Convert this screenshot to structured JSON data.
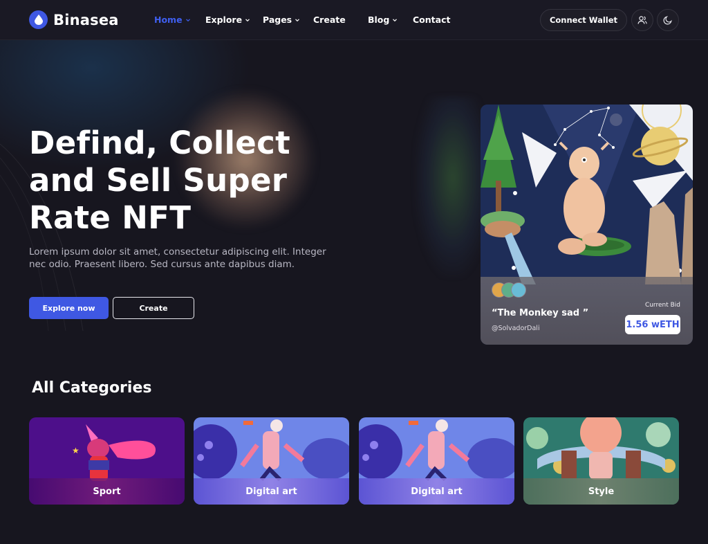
{
  "brand": {
    "name": "Binasea"
  },
  "nav": {
    "items": [
      {
        "label": "Home",
        "active": true,
        "has_dropdown": true
      },
      {
        "label": "Explore",
        "active": false,
        "has_dropdown": true
      },
      {
        "label": "Pages",
        "active": false,
        "has_dropdown": true
      },
      {
        "label": "Create",
        "active": false,
        "has_dropdown": false
      },
      {
        "label": "Blog",
        "active": false,
        "has_dropdown": true
      },
      {
        "label": "Contact",
        "active": false,
        "has_dropdown": false
      }
    ],
    "connect_wallet": "Connect Wallet",
    "icons": [
      "user-icon",
      "moon-icon"
    ]
  },
  "hero": {
    "title": "Defind, Collect and Sell Super Rate NFT",
    "description": "Lorem ipsum dolor sit amet, consectetur adipiscing elit. Integer nec odio. Praesent libero. Sed cursus ante dapibus diam.",
    "explore_button": "Explore now",
    "create_button": "Create"
  },
  "nft_card": {
    "title": "“The Monkey sad ”",
    "author": "@SolvadorDali",
    "bid_label": "Current Bid",
    "bid_value": "1.56 wETH"
  },
  "categories": {
    "title": "All Categories",
    "items": [
      {
        "label": "Sport"
      },
      {
        "label": "Digital art"
      },
      {
        "label": "Digital art"
      },
      {
        "label": "Style"
      }
    ]
  },
  "colors": {
    "background": "#17161f",
    "accent": "#3f58e3",
    "active_nav": "#3f5ff0"
  }
}
